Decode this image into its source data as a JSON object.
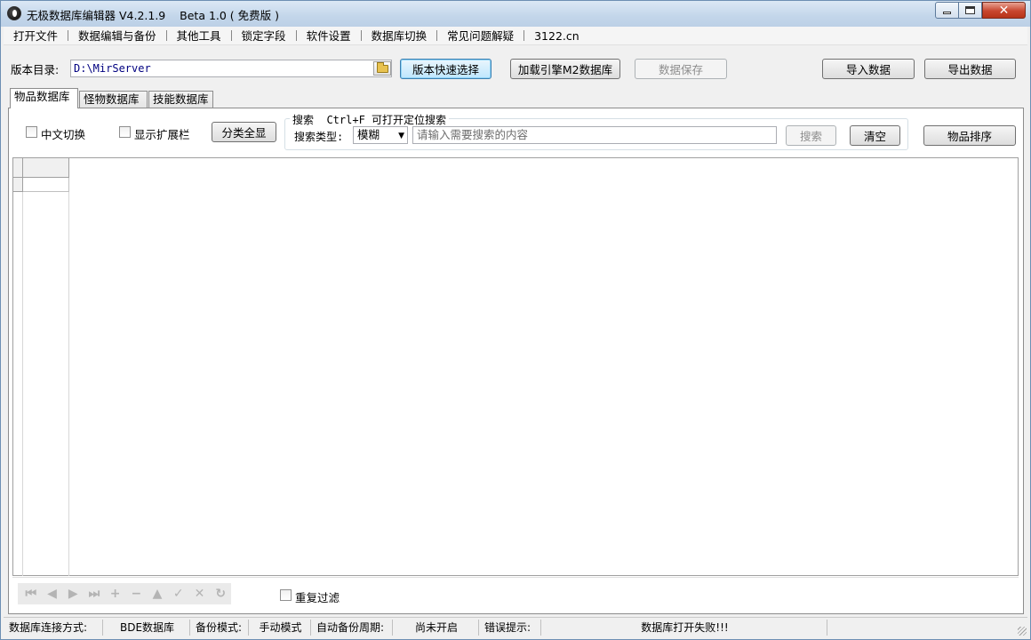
{
  "window": {
    "title": "无极数据库编辑器 V4.2.1.9    Beta 1.0 ( 免费版 )",
    "close_glyph": "✕"
  },
  "menu": {
    "items": [
      "打开文件",
      "数据编辑与备份",
      "其他工具",
      "锁定字段",
      "软件设置",
      "数据库切换",
      "常见问题解疑",
      "3122.cn"
    ]
  },
  "toolbar": {
    "version_dir_label": "版本目录:",
    "version_dir_value": "D:\\MirServer",
    "quick_select_label": "版本快速选择",
    "load_m2_label": "加载引擎M2数据库",
    "save_label": "数据保存",
    "import_label": "导入数据",
    "export_label": "导出数据"
  },
  "tabs": [
    "物品数据库",
    "怪物数据库",
    "技能数据库"
  ],
  "panel": {
    "chinese_toggle_label": "中文切换",
    "show_ext_label": "显示扩展栏",
    "show_all_label": "分类全显",
    "search_group_title": "搜索  Ctrl+F 可打开定位搜索",
    "search_type_label": "搜索类型:",
    "search_type_value": "模糊",
    "search_placeholder": "请输入需要搜索的内容",
    "search_button": "搜索",
    "clear_button": "清空",
    "sort_button": "物品排序",
    "repeat_filter_label": "重复过滤"
  },
  "navigator": {
    "buttons": [
      {
        "icon": "first-record-icon",
        "glyph": "⏮"
      },
      {
        "icon": "prior-record-icon",
        "glyph": "◀"
      },
      {
        "icon": "next-record-icon",
        "glyph": "▶"
      },
      {
        "icon": "last-record-icon",
        "glyph": "⏭"
      },
      {
        "icon": "insert-record-icon",
        "glyph": "+"
      },
      {
        "icon": "delete-record-icon",
        "glyph": "−"
      },
      {
        "icon": "edit-record-icon",
        "glyph": "▲"
      },
      {
        "icon": "post-record-icon",
        "glyph": "✓"
      },
      {
        "icon": "cancel-record-icon",
        "glyph": "✕"
      },
      {
        "icon": "refresh-record-icon",
        "glyph": "↻"
      }
    ]
  },
  "statusbar": {
    "conn_label": "数据库连接方式:",
    "conn_value": "BDE数据库",
    "backup_label": "备份模式:",
    "backup_value": "手动模式",
    "auto_backup_label": "自动备份周期:",
    "auto_backup_value": "尚未开启",
    "error_label": "错误提示:",
    "error_value": "数据库打开失败!!!"
  }
}
